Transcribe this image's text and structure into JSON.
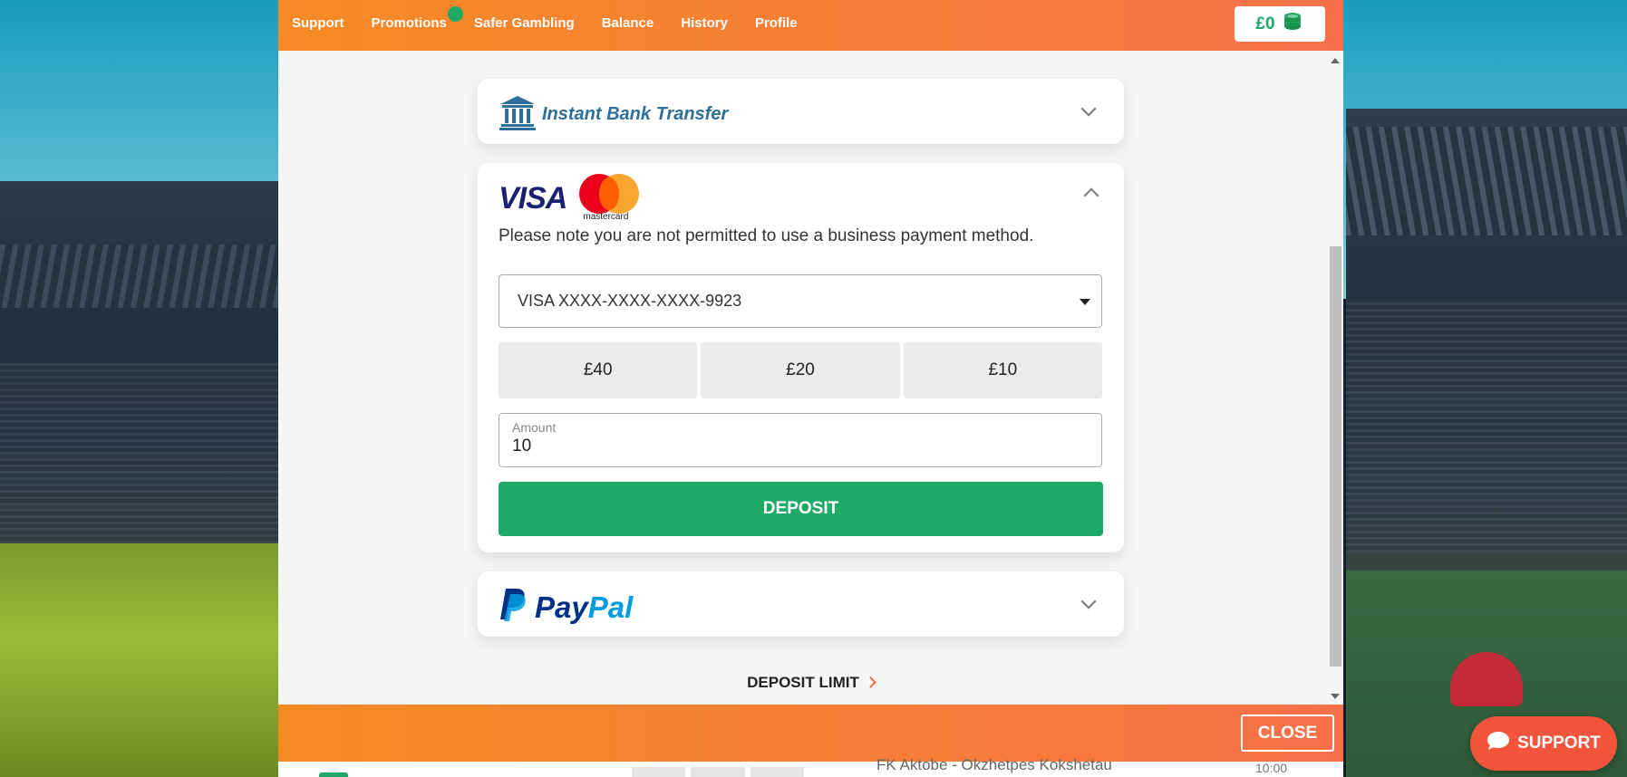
{
  "topbar": {
    "nav": [
      "Support",
      "Promotions",
      "Safer Gambling",
      "Balance",
      "History",
      "Profile"
    ],
    "balance": "£0",
    "balance_icon": "coins-icon",
    "colors": {
      "orange_start": "#f58a24",
      "orange_end": "#f7704a",
      "green": "#1fa865"
    }
  },
  "payment_methods": {
    "bank": {
      "label": "Instant Bank Transfer",
      "icon": "bank-icon",
      "expanded": false
    },
    "card": {
      "visa_label": "VISA",
      "mastercard_label": "mastercard",
      "expanded": true,
      "note": "Please note you are not permitted to use a business payment method.",
      "selected_card": "VISA XXXX-XXXX-XXXX-9923",
      "quick_amounts": [
        "£40",
        "£20",
        "£10"
      ],
      "amount_label": "Amount",
      "amount_value": "10",
      "deposit_label": "DEPOSIT"
    },
    "paypal": {
      "label_pay": "Pay",
      "label_pal": "Pal",
      "mark": "P",
      "expanded": false
    }
  },
  "deposit_limit_label": "DEPOSIT LIMIT",
  "close_label": "CLOSE",
  "support_label": "SUPPORT",
  "underlay": {
    "match": "FK Aktobe - Okzhetpes Kokshetau",
    "time": "10:00"
  }
}
